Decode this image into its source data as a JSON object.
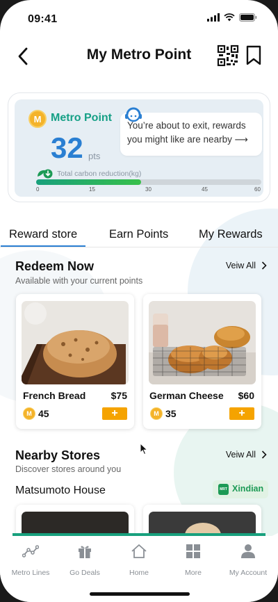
{
  "status_bar": {
    "time": "09:41"
  },
  "header": {
    "title": "My Metro Point"
  },
  "points_card": {
    "badge_letter": "M",
    "label": "Metro Point",
    "points": "32",
    "unit": "pts",
    "exit_message_line1": "You’re about to exit, rewards",
    "exit_message_line2": "you might like are nearby ⟶",
    "carbon_label": "Total carbon reduction(kg)",
    "carbon_value": 28,
    "carbon_ticks": [
      "0",
      "15",
      "30",
      "45",
      "60"
    ],
    "carbon_max": 60
  },
  "tabs": [
    {
      "label": "Reward store",
      "active": true
    },
    {
      "label": "Earn Points",
      "active": false
    },
    {
      "label": "My Rewards",
      "active": false
    }
  ],
  "redeem": {
    "title": "Redeem Now",
    "subtitle": "Available with your current points",
    "view_all": "Veiw All",
    "products": [
      {
        "name": "French Bread",
        "price": "$75",
        "points": "45",
        "add": "+"
      },
      {
        "name": "German Cheese",
        "price": "$60",
        "points": "35",
        "add": "+"
      }
    ]
  },
  "nearby": {
    "title": "Nearby Stores",
    "subtitle": "Discover stores around you",
    "view_all": "Veiw All",
    "store_name": "Matsumoto House",
    "district": "Xindian",
    "district_icon_text": "MRT"
  },
  "bottom_nav": [
    {
      "label": "Metro Lines",
      "icon": "metro-lines-icon"
    },
    {
      "label": "Go Deals",
      "icon": "gift-icon"
    },
    {
      "label": "Home",
      "icon": "home-icon"
    },
    {
      "label": "More",
      "icon": "grid-icon"
    },
    {
      "label": "My Account",
      "icon": "person-icon"
    }
  ],
  "colors": {
    "accent_blue": "#2a7fd2",
    "accent_green": "#16a086",
    "accent_orange": "#f5a300",
    "coin_gold": "#f4b32a"
  }
}
